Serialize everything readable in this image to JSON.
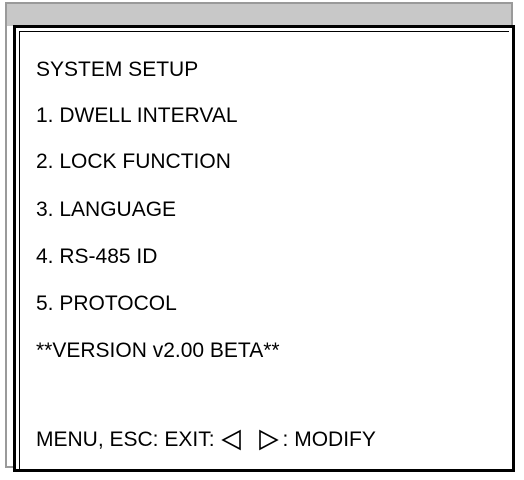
{
  "menu": {
    "title": "SYSTEM SETUP",
    "items": [
      {
        "label": "1. DWELL INTERVAL"
      },
      {
        "label": "2. LOCK FUNCTION"
      },
      {
        "label": "3. LANGUAGE"
      },
      {
        "label": "4. RS-485 ID"
      },
      {
        "label": "5. PROTOCOL"
      }
    ],
    "version": "**VERSION v2.00 BETA**"
  },
  "footer": {
    "exit_text": "MENU, ESC:  EXIT:",
    "modify_text": ": MODIFY",
    "icons": [
      "left-triangle-icon",
      "right-triangle-icon"
    ]
  }
}
